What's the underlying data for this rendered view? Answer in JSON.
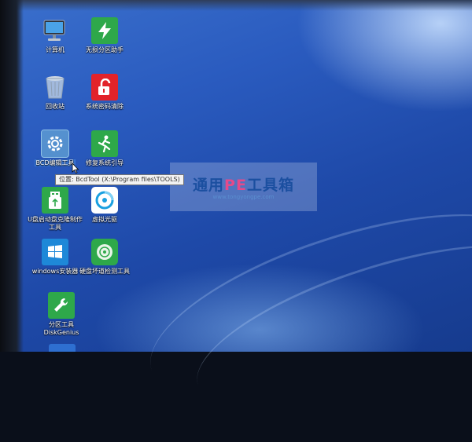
{
  "desktop": {
    "icons": [
      {
        "label": "计算机"
      },
      {
        "label": "无损分区助手"
      },
      {
        "label": "回收站"
      },
      {
        "label": "系统密码清除"
      },
      {
        "label": "BCD编辑工具"
      },
      {
        "label": "修复系统引导"
      },
      {
        "label": "U盘启动盘克隆制作工具"
      },
      {
        "label": "虚拟光驱"
      },
      {
        "label": "windows安装器"
      },
      {
        "label": "硬盘坏道检测工具"
      },
      {
        "label": "分区工具DiskGenius"
      }
    ]
  },
  "tooltip": {
    "text": "位置: BcdTool (X:\\Program files\\TOOLS)"
  },
  "watermark": {
    "title_a": "通用",
    "title_b": "PE",
    "title_c": "工具箱",
    "url": "www.tongyongpe.com"
  },
  "colors": {
    "desktop_blue": "#2a5bbf",
    "brand_blue": "#1b4fa0",
    "brand_pink": "#e54a8a"
  }
}
